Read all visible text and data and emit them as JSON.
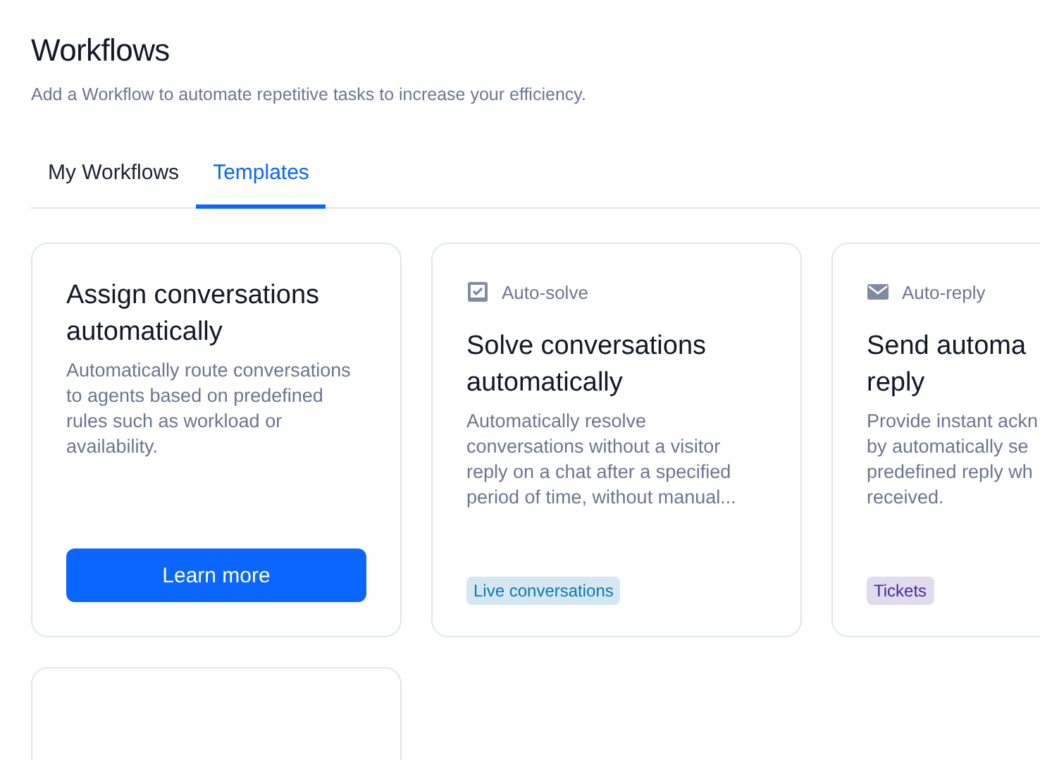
{
  "header": {
    "title": "Workflows",
    "subtitle": "Add a Workflow to automate repetitive tasks to increase your efficiency."
  },
  "tabs": [
    {
      "label": "My Workflows",
      "selected": false
    },
    {
      "label": "Templates",
      "selected": true
    }
  ],
  "cards": [
    {
      "kind": "action",
      "title": "Assign conversations automatically",
      "description": "Automatically route conversations to agents based on predefined rules such as workload or availability.",
      "button": "Learn more"
    },
    {
      "kind": "tagged",
      "category": "Auto-solve",
      "title": "Solve conversations automatically",
      "description": "Automatically resolve conversations without a visitor reply on a chat after a specified period of time, without manual...",
      "tag": {
        "label": "Live conversations",
        "color": "#0a78b4"
      }
    },
    {
      "kind": "tagged",
      "category": "Auto-reply",
      "title": "Send automa\nreply",
      "description": "Provide instant ackn\nby automatically se\npredefined reply wh\nreceived.",
      "tag": {
        "label": "Tickets",
        "color": "#4a2a9a"
      }
    },
    {
      "kind": "blank"
    }
  ]
}
